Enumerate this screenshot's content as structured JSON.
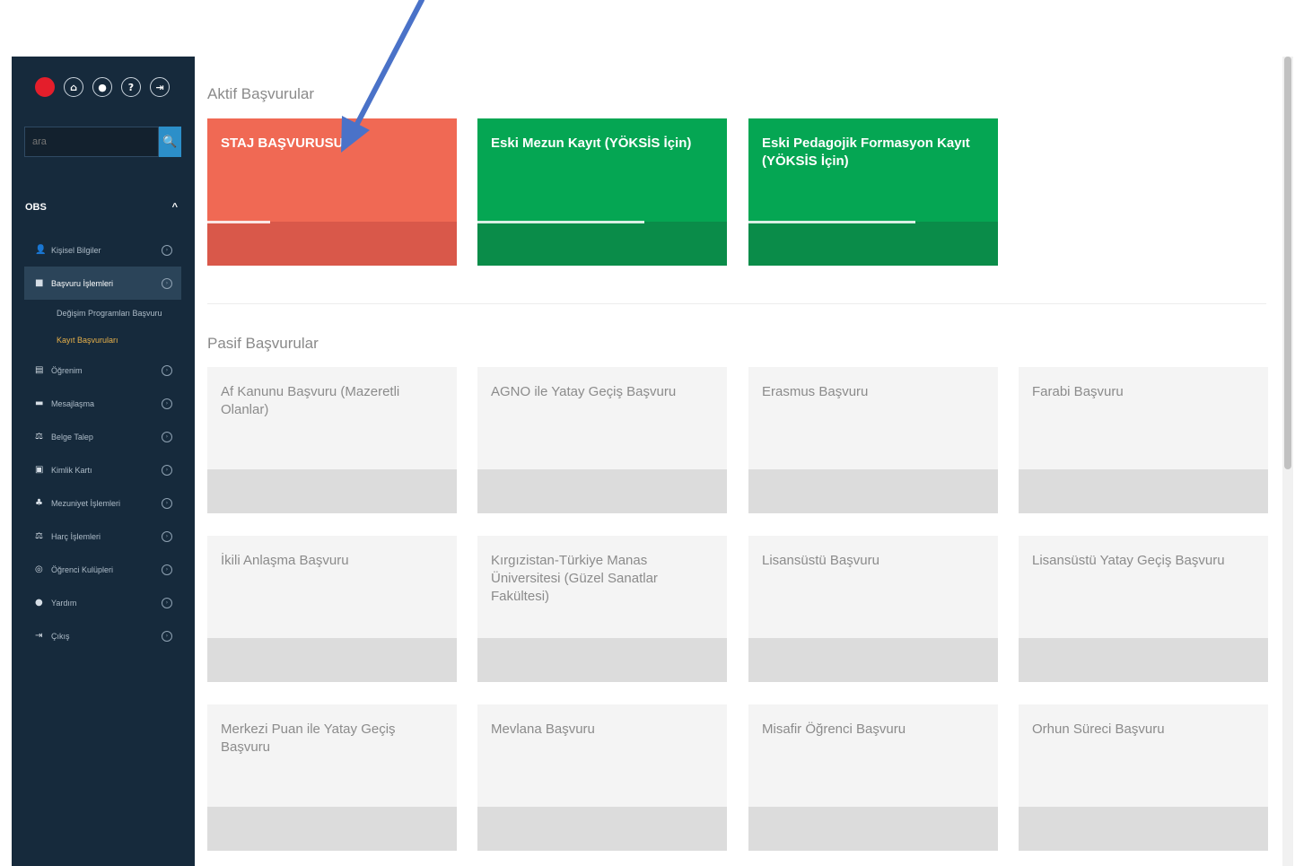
{
  "sidebar": {
    "top_icons": [
      {
        "name": "flag-icon",
        "glyph": ""
      },
      {
        "name": "home-icon",
        "glyph": "⌂"
      },
      {
        "name": "message-icon",
        "glyph": "●"
      },
      {
        "name": "help-icon",
        "glyph": "?"
      },
      {
        "name": "logout-icon",
        "glyph": "⇥"
      }
    ],
    "search": {
      "placeholder": "ara",
      "button_glyph": "🔍"
    },
    "section": {
      "label": "OBS",
      "chevron": "^"
    },
    "menu": [
      {
        "label": "Kişisel Bilgiler",
        "icon": "user-icon",
        "glyph": "👤"
      },
      {
        "label": "Başvuru İşlemleri",
        "icon": "briefcase-icon",
        "glyph": "■"
      },
      {
        "label": "Değişim Programları Başvuru",
        "sub": true
      },
      {
        "label": "Kayıt Başvuruları",
        "sub": true
      },
      {
        "label": "Öğrenim",
        "icon": "book-icon",
        "glyph": "▤"
      },
      {
        "label": "Mesajlaşma",
        "icon": "message-icon",
        "glyph": "▬"
      },
      {
        "label": "Belge Talep",
        "icon": "document-icon",
        "glyph": "⚖"
      },
      {
        "label": "Kimlik Kartı",
        "icon": "id-card-icon",
        "glyph": "▣"
      },
      {
        "label": "Mezuniyet İşlemleri",
        "icon": "graduation-icon",
        "glyph": "♣"
      },
      {
        "label": "Harç İşlemleri",
        "icon": "fee-icon",
        "glyph": "⚖"
      },
      {
        "label": "Öğrenci Kulüpleri",
        "icon": "club-icon",
        "glyph": "◎"
      },
      {
        "label": "Yardım",
        "icon": "help-icon",
        "glyph": "●"
      },
      {
        "label": "Çıkış",
        "icon": "exit-icon",
        "glyph": "⇥"
      }
    ],
    "menu_arrow": "›"
  },
  "main": {
    "active_title": "Aktif Başvurular",
    "passive_title": "Pasif Başvurular",
    "active_cards": [
      {
        "title": "STAJ BAŞVURUSU",
        "color": "#f06954",
        "progress": 0.25
      },
      {
        "title": "Eski Mezun Kayıt (YÖKSİS İçin)",
        "color": "#05a653",
        "progress": 0.67
      },
      {
        "title": "Eski Pedagojik Formasyon Kayıt (YÖKSİS İçin)",
        "color": "#05a653",
        "progress": 0.67
      }
    ],
    "passive_cards": [
      "Af Kanunu Başvuru (Mazeretli Olanlar)",
      "AGNO ile Yatay Geçiş Başvuru",
      "Erasmus Başvuru",
      "Farabi Başvuru",
      "İkili Anlaşma Başvuru",
      "Kırgızistan-Türkiye Manas Üniversitesi (Güzel Sanatlar Fakültesi)",
      "Lisansüstü Başvuru",
      "Lisansüstü Yatay Geçiş Başvuru",
      "Merkezi Puan ile Yatay Geçiş Başvuru",
      "Mevlana Başvuru",
      "Misafir Öğrenci Başvuru",
      "Orhun Süreci Başvuru"
    ]
  },
  "colors": {
    "sidebar_bg": "#162a3c",
    "accent_red": "#f06954",
    "accent_green": "#05a653",
    "annotation_arrow": "#4a72c8"
  }
}
